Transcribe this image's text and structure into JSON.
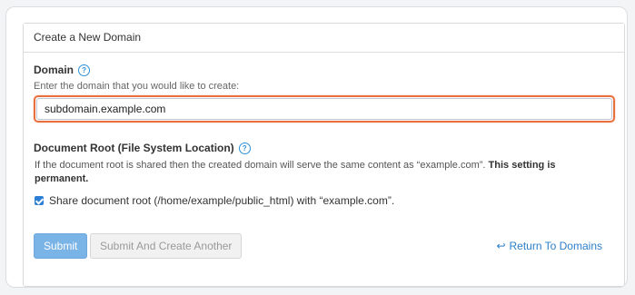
{
  "panel": {
    "title": "Create a New Domain"
  },
  "domain": {
    "label": "Domain",
    "help": "?",
    "hint": "Enter the domain that you would like to create:",
    "value": "subdomain.example.com"
  },
  "document_root": {
    "label": "Document Root (File System Location)",
    "help": "?",
    "description": "If the document root is shared then the created domain will serve the same content as “example.com”.",
    "description_bold": "This setting is permanent.",
    "checkbox_checked": true,
    "checkbox_label": "Share document root (/home/example/public_html) with “example.com”."
  },
  "actions": {
    "submit_label": "Submit",
    "submit_another_label": "Submit And Create Another",
    "return_label": "Return To Domains",
    "return_icon": "reply-arrow-icon"
  },
  "colors": {
    "accent": "#2d7fd6",
    "focus_border": "#e8703f",
    "primary_button": "#7ab3e6"
  }
}
